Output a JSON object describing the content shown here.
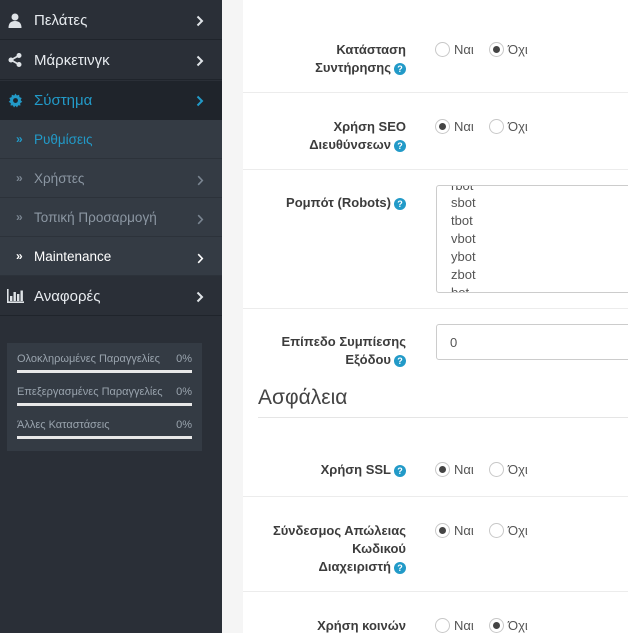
{
  "sidebar": {
    "menu": [
      {
        "label": "Πελάτες",
        "icon": "user-icon"
      },
      {
        "label": "Μάρκετινγκ",
        "icon": "share-icon"
      },
      {
        "label": "Σύστημα",
        "icon": "gear-icon"
      }
    ],
    "submenu": [
      {
        "label": "Ρυθμίσεις"
      },
      {
        "label": "Χρήστες"
      },
      {
        "label": "Τοπική Προσαρμογή"
      },
      {
        "label": "Maintenance"
      }
    ],
    "reports": {
      "label": "Αναφορές",
      "icon": "bar-chart-icon"
    },
    "stats": [
      {
        "label": "Ολοκληρωμένες Παραγγελίες",
        "value": "0%"
      },
      {
        "label": "Επεξεργασμένες Παραγγελίες",
        "value": "0%"
      },
      {
        "label": "Άλλες Καταστάσεις",
        "value": "0%"
      }
    ]
  },
  "form": {
    "yes": "Ναι",
    "no": "Όχι",
    "maintenance": {
      "label_line1": "Κατάσταση",
      "label_line2": "Συντήρησης",
      "value": "no"
    },
    "seo": {
      "label_line1": "Χρήση SEO",
      "label_line2": "Διευθύνσεων",
      "value": "yes"
    },
    "robots": {
      "label": "Ρομπότ (Robots)",
      "bots": [
        "rbot",
        "sbot",
        "tbot",
        "vbot",
        "ybot",
        "zbot",
        "bot"
      ]
    },
    "compression": {
      "label_line1": "Επίπεδο Συμπίεσης",
      "label_line2": "Εξόδου",
      "value": "0"
    },
    "security_heading": "Ασφάλεια",
    "ssl": {
      "label": "Χρήση SSL",
      "value": "yes"
    },
    "password_link": {
      "label_line1": "Σύνδεσμος Απώλειας",
      "label_line2": "Κωδικού",
      "label_line3": "Διαχειριστή",
      "value": "yes"
    },
    "shared": {
      "label_line1": "Χρήση κοινών",
      "value": "no"
    }
  },
  "colors": {
    "accent": "#229ac8",
    "sidebar": "#2a2f37"
  }
}
